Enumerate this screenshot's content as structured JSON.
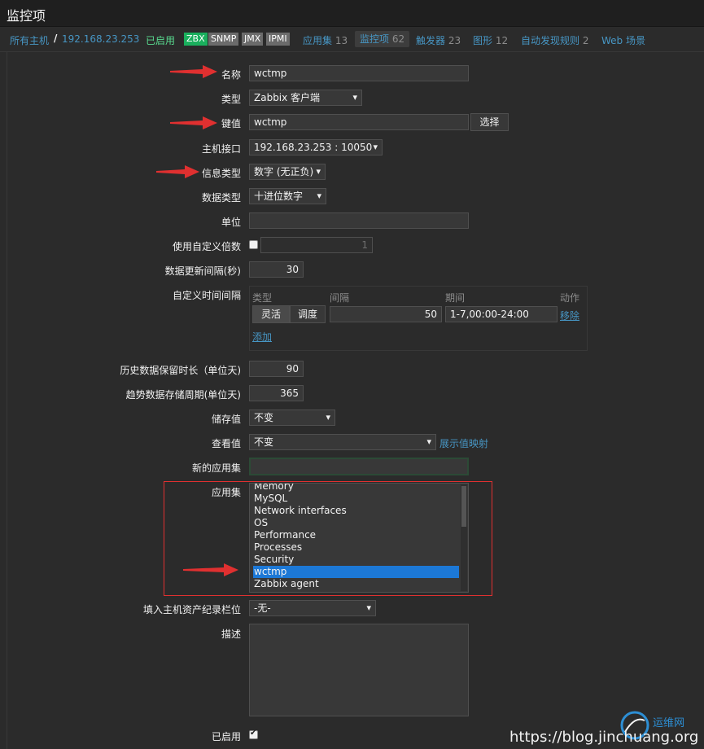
{
  "header": {
    "title": "监控项"
  },
  "nav": {
    "all_hosts": "所有主机",
    "host_ip": "192.168.23.253",
    "enabled": "已启用",
    "protocols": [
      "ZBX",
      "SNMP",
      "JMX",
      "IPMI"
    ],
    "protocol_colors": {
      "ZBX": "#1aaf5d",
      "SNMP": "#6b6b6b",
      "JMX": "#6b6b6b",
      "IPMI": "#6b6b6b"
    },
    "tabs": [
      {
        "label": "应用集",
        "count": "13"
      },
      {
        "label": "监控项",
        "count": "62",
        "active": true
      },
      {
        "label": "触发器",
        "count": "23"
      },
      {
        "label": "图形",
        "count": "12"
      },
      {
        "label": "自动发现规则",
        "count": "2"
      },
      {
        "label": "Web 场景",
        "count": ""
      }
    ]
  },
  "form": {
    "name": {
      "label": "名称",
      "value": "wctmp"
    },
    "type": {
      "label": "类型",
      "value": "Zabbix 客户端"
    },
    "key": {
      "label": "键值",
      "value": "wctmp",
      "select_button": "选择"
    },
    "host_interface": {
      "label": "主机接口",
      "value": "192.168.23.253 : 10050"
    },
    "info_type": {
      "label": "信息类型",
      "value": "数字 (无正负)"
    },
    "data_type": {
      "label": "数据类型",
      "value": "十进位数字"
    },
    "units": {
      "label": "单位",
      "value": ""
    },
    "custom_multiplier": {
      "label": "使用自定义倍数",
      "value": "1",
      "checked": false
    },
    "update_interval": {
      "label": "数据更新间隔(秒)",
      "value": "30"
    },
    "custom_intervals": {
      "label": "自定义时间间隔",
      "headers": [
        "类型",
        "间隔",
        "期间",
        "动作"
      ],
      "row": {
        "type_flexible": "灵活",
        "type_scheduling": "调度",
        "interval": "50",
        "period": "1-7,00:00-24:00",
        "remove": "移除"
      },
      "add": "添加"
    },
    "history": {
      "label": "历史数据保留时长（单位天)",
      "value": "90"
    },
    "trends": {
      "label": "趋势数据存储周期(单位天)",
      "value": "365"
    },
    "store_value": {
      "label": "储存值",
      "value": "不变"
    },
    "show_value": {
      "label": "查看值",
      "value": "不变",
      "mapping_link": "展示值映射"
    },
    "new_application": {
      "label": "新的应用集",
      "value": ""
    },
    "applications": {
      "label": "应用集",
      "items": [
        "Memory",
        "MySQL",
        "Network interfaces",
        "OS",
        "Performance",
        "Processes",
        "Security",
        "wctmp",
        "Zabbix agent"
      ],
      "selected": "wctmp"
    },
    "inventory": {
      "label": "填入主机资产纪录栏位",
      "value": "-无-"
    },
    "description": {
      "label": "描述",
      "value": ""
    },
    "enabled": {
      "label": "已启用",
      "checked": true
    }
  },
  "watermark": {
    "url": "https://blog.jinchuang.org",
    "logo_text": "运维网"
  }
}
